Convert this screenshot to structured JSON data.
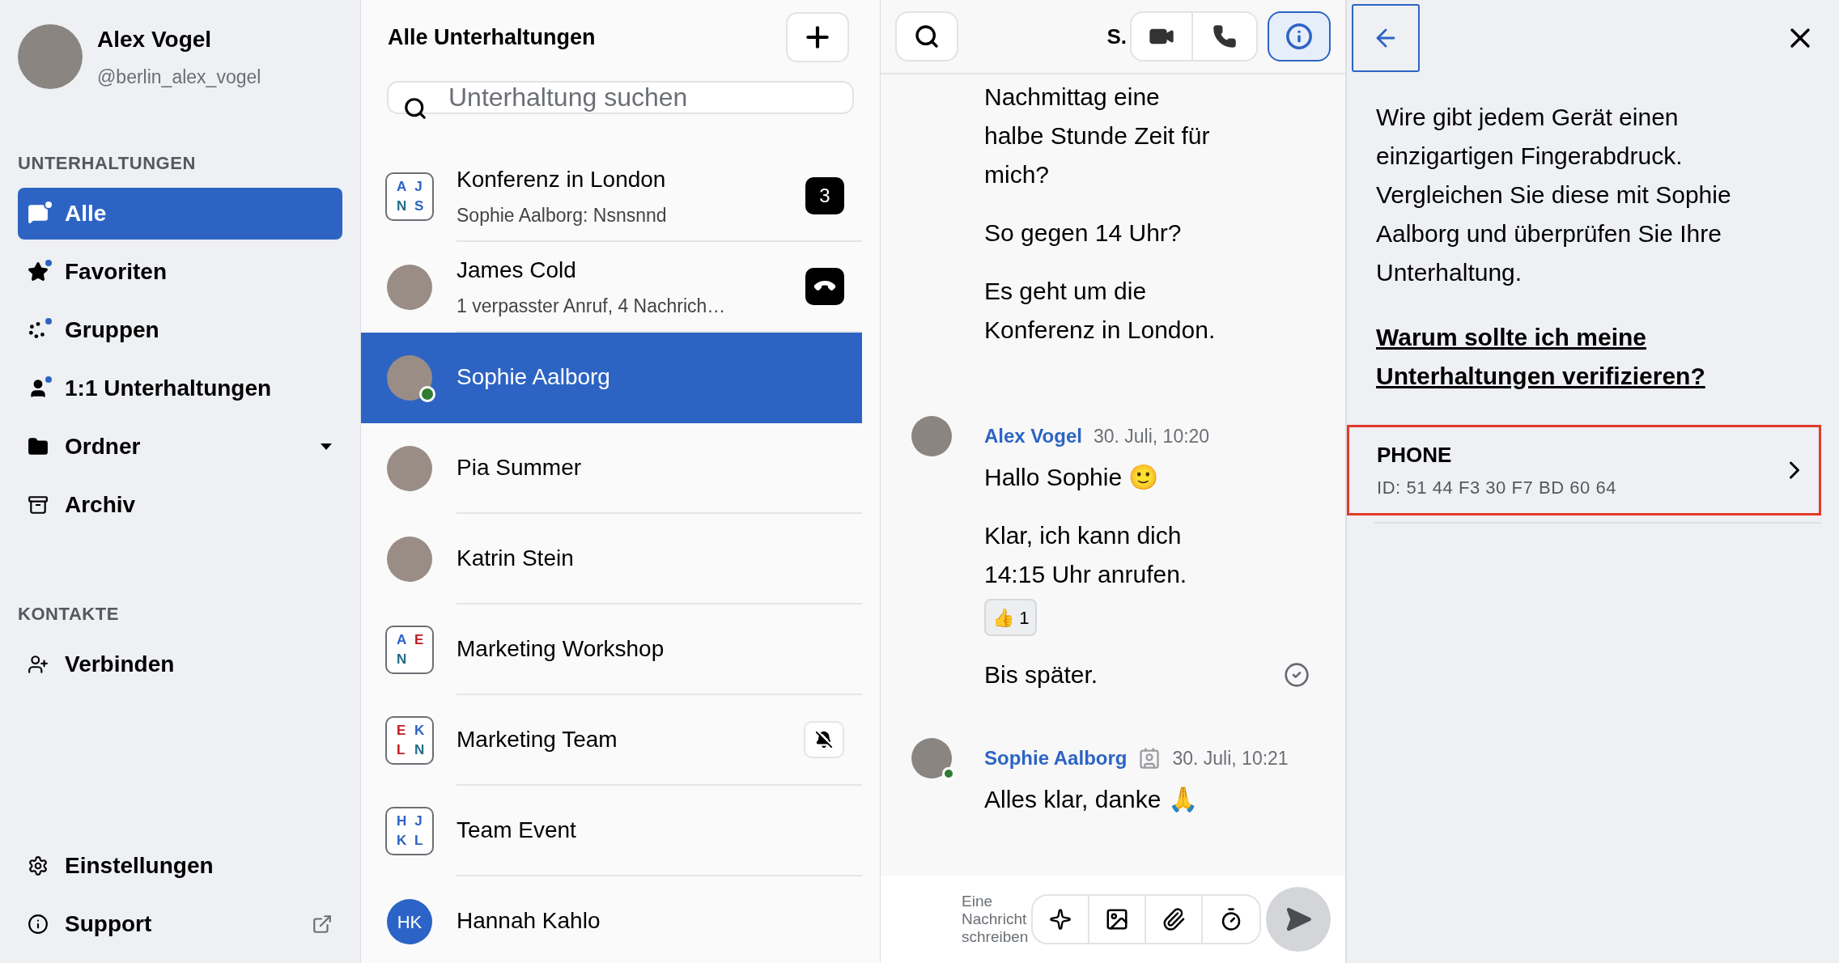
{
  "profile": {
    "name": "Alex Vogel",
    "handle": "@berlin_alex_vogel"
  },
  "sidebar": {
    "sections": [
      {
        "title": "UNTERHALTUNGEN",
        "items": [
          {
            "label": "Alle",
            "kind": "chat",
            "selected": true,
            "unread": true
          },
          {
            "label": "Favoriten",
            "kind": "star",
            "selected": false,
            "unread": true
          },
          {
            "label": "Gruppen",
            "kind": "group",
            "selected": false,
            "unread": true
          },
          {
            "label": "1:1 Unterhaltungen",
            "kind": "person",
            "selected": false,
            "unread": true
          },
          {
            "label": "Ordner",
            "kind": "folder",
            "selected": false,
            "unread": false,
            "dropdown": true
          },
          {
            "label": "Archiv",
            "kind": "archive",
            "selected": false,
            "unread": false
          }
        ]
      },
      {
        "title": "KONTAKTE",
        "items": [
          {
            "label": "Verbinden",
            "kind": "add_person",
            "selected": false,
            "unread": false
          }
        ]
      }
    ],
    "footer": [
      {
        "label": "Einstellungen",
        "kind": "settings",
        "external": false
      },
      {
        "label": "Support",
        "kind": "info",
        "external": true
      }
    ]
  },
  "conversations": {
    "title": "Alle Unterhaltungen",
    "search": {
      "placeholder": "Unterhaltung suchen"
    },
    "items": [
      {
        "name": "Konferenz in London",
        "preview": "Sophie Aalborg: Nsnsnnd",
        "avatar": {
          "kind": "group",
          "letters": [
            {
              "char": "A",
              "color": "#2b63c6"
            },
            {
              "char": "J",
              "color": "#2b63c6"
            },
            {
              "char": "N",
              "color": "#226d8a"
            },
            {
              "char": "S",
              "color": "#2b63c6"
            }
          ]
        },
        "badge": {
          "kind": "count",
          "text": "3"
        },
        "selected": false,
        "online": false
      },
      {
        "name": "James Cold",
        "preview": "1 verpasster Anruf, 4 Nachrich…",
        "avatar": {
          "kind": "photo"
        },
        "badge": {
          "kind": "missed_call"
        },
        "selected": false,
        "online": false
      },
      {
        "name": "Sophie Aalborg",
        "avatar": {
          "kind": "photo"
        },
        "selected": true,
        "online": true
      },
      {
        "name": "Pia Summer",
        "avatar": {
          "kind": "photo"
        },
        "selected": false,
        "online": false
      },
      {
        "name": "Katrin Stein",
        "avatar": {
          "kind": "photo"
        },
        "selected": false,
        "online": false
      },
      {
        "name": "Marketing Workshop",
        "avatar": {
          "kind": "group",
          "letters": [
            {
              "char": "A",
              "color": "#2b63c6"
            },
            {
              "char": "E",
              "color": "#c2191f"
            },
            {
              "char": "N",
              "color": "#226d8a"
            }
          ]
        },
        "selected": false,
        "online": false
      },
      {
        "name": "Marketing Team",
        "avatar": {
          "kind": "group",
          "letters": [
            {
              "char": "E",
              "color": "#c2191f"
            },
            {
              "char": "K",
              "color": "#2b63c6"
            },
            {
              "char": "L",
              "color": "#c2191f"
            },
            {
              "char": "N",
              "color": "#226d8a"
            }
          ]
        },
        "badge": {
          "kind": "muted"
        },
        "selected": false,
        "online": false
      },
      {
        "name": "Team Event",
        "avatar": {
          "kind": "group",
          "letters": [
            {
              "char": "H",
              "color": "#2b63c6"
            },
            {
              "char": "J",
              "color": "#2b63c6"
            },
            {
              "char": "K",
              "color": "#2b63c6"
            },
            {
              "char": "L",
              "color": "#2b63c6"
            }
          ]
        },
        "selected": false,
        "online": false
      },
      {
        "name": "Hannah Kahlo",
        "avatar": {
          "kind": "initials",
          "text": "HK"
        },
        "selected": false,
        "online": false
      }
    ]
  },
  "chat": {
    "title": "S.",
    "info_open": true,
    "groups": [
      {
        "messages": [
          {
            "text": "Nachmittag eine\nhalbe Stunde Zeit für\nmich?"
          },
          {
            "text": "So gegen 14 Uhr?"
          },
          {
            "text": "Es geht um die\nKonferenz in London."
          }
        ]
      },
      {
        "sender": {
          "name": "Alex Vogel",
          "time": "30. Juli, 10:20",
          "online": false,
          "id_badge": false
        },
        "messages": [
          {
            "text": "Hallo Sophie 🙂"
          },
          {
            "text": "Klar, ich kann dich\n14:15 Uhr anrufen.",
            "reaction": {
              "emoji": "👍",
              "count": "1"
            }
          },
          {
            "text": "Bis später.",
            "delivered": true
          }
        ]
      },
      {
        "sender": {
          "name": "Sophie Aalborg",
          "time": "30. Juli, 10:21",
          "online": true,
          "id_badge": true
        },
        "messages": [
          {
            "text": "Alles klar, danke 🙏"
          }
        ]
      }
    ],
    "composer": {
      "placeholder": "Eine Nachricht schreiben"
    }
  },
  "details": {
    "description": "Wire gibt jedem Gerät einen einzigartigen Fingerabdruck. Vergleichen Sie diese mit Sophie Aalborg und überprüfen Sie Ihre Unterhaltung.",
    "link": "Warum sollte ich meine Unterhaltungen verifizieren?",
    "devices": [
      {
        "name": "PHONE",
        "id": "ID: 51 44 F3 30 F7 BD 60 64",
        "selected": true
      }
    ]
  }
}
